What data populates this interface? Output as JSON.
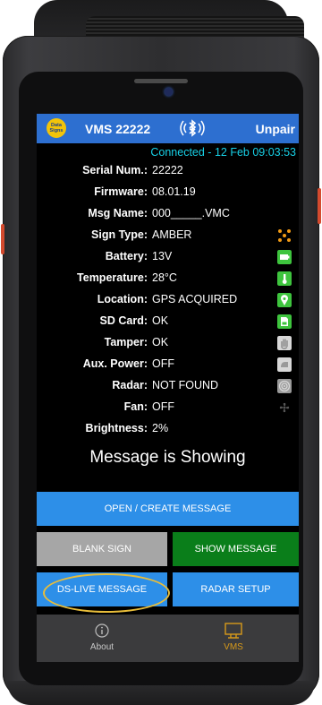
{
  "header": {
    "logo_text_line1": "Data",
    "logo_text_line2": "Signs",
    "title": "VMS 22222",
    "unpair_label": "Unpair"
  },
  "status": {
    "connection": "Connected - 12 Feb 09:03:53"
  },
  "info_rows": [
    {
      "label": "Serial Num.:",
      "value": "22222"
    },
    {
      "label": "Firmware:",
      "value": "08.01.19"
    },
    {
      "label": "Msg Name:",
      "value": "000_____.VMC"
    },
    {
      "label": "Sign Type:",
      "value": "AMBER",
      "icon": "amber-dots-icon"
    },
    {
      "label": "Battery:",
      "value": "13V",
      "icon": "battery-icon"
    },
    {
      "label": "Temperature:",
      "value": "28°C",
      "icon": "thermometer-icon"
    },
    {
      "label": "Location:",
      "value": "GPS ACQUIRED",
      "icon": "location-pin-icon"
    },
    {
      "label": "SD Card:",
      "value": "OK",
      "icon": "sd-card-icon"
    },
    {
      "label": "Tamper:",
      "value": "OK",
      "icon": "hand-icon"
    },
    {
      "label": "Aux. Power:",
      "value": "OFF",
      "icon": "power-plug-icon"
    },
    {
      "label": "Radar:",
      "value": "NOT FOUND",
      "icon": "radar-icon"
    },
    {
      "label": "Fan:",
      "value": "OFF",
      "icon": "fan-icon"
    },
    {
      "label": "Brightness:",
      "value": "2%"
    }
  ],
  "message_status": "Message is Showing",
  "buttons": {
    "open_create": "OPEN / CREATE MESSAGE",
    "blank_sign": "BLANK SIGN",
    "show_message": "SHOW MESSAGE",
    "ds_live": "DS-LIVE MESSAGE",
    "radar_setup": "RADAR SETUP"
  },
  "nav": {
    "about": "About",
    "vms": "VMS",
    "active": "VMS"
  },
  "colors": {
    "header_blue": "#2d6fd0",
    "status_cyan": "#17d0e6",
    "button_blue": "#2d8fe8",
    "button_green": "#0a7e1a",
    "button_gray": "#a6a6a6",
    "status_icon_green": "#3ec43e",
    "nav_active": "#d89a1a",
    "highlight": "#e8bd3a"
  }
}
